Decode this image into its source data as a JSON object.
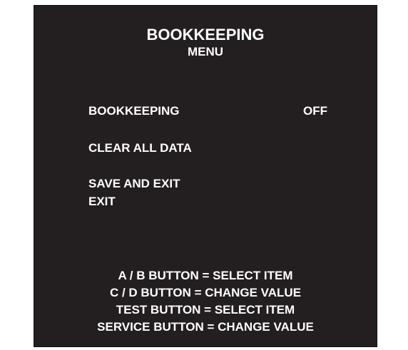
{
  "header": {
    "title": "BOOKKEEPING",
    "subtitle": "MENU"
  },
  "menu": {
    "items": [
      {
        "label": "BOOKKEEPING",
        "value": "OFF"
      },
      {
        "label": "CLEAR ALL DATA"
      },
      {
        "label": "SAVE AND EXIT"
      },
      {
        "label": "EXIT"
      }
    ]
  },
  "help": {
    "lines": [
      "A / B BUTTON = SELECT ITEM",
      "C / D BUTTON = CHANGE  VALUE",
      "TEST BUTTON = SELECT ITEM",
      "SERVICE BUTTON = CHANGE  VALUE"
    ]
  },
  "colors": {
    "background": "#231f20",
    "text": "#ffffff"
  }
}
